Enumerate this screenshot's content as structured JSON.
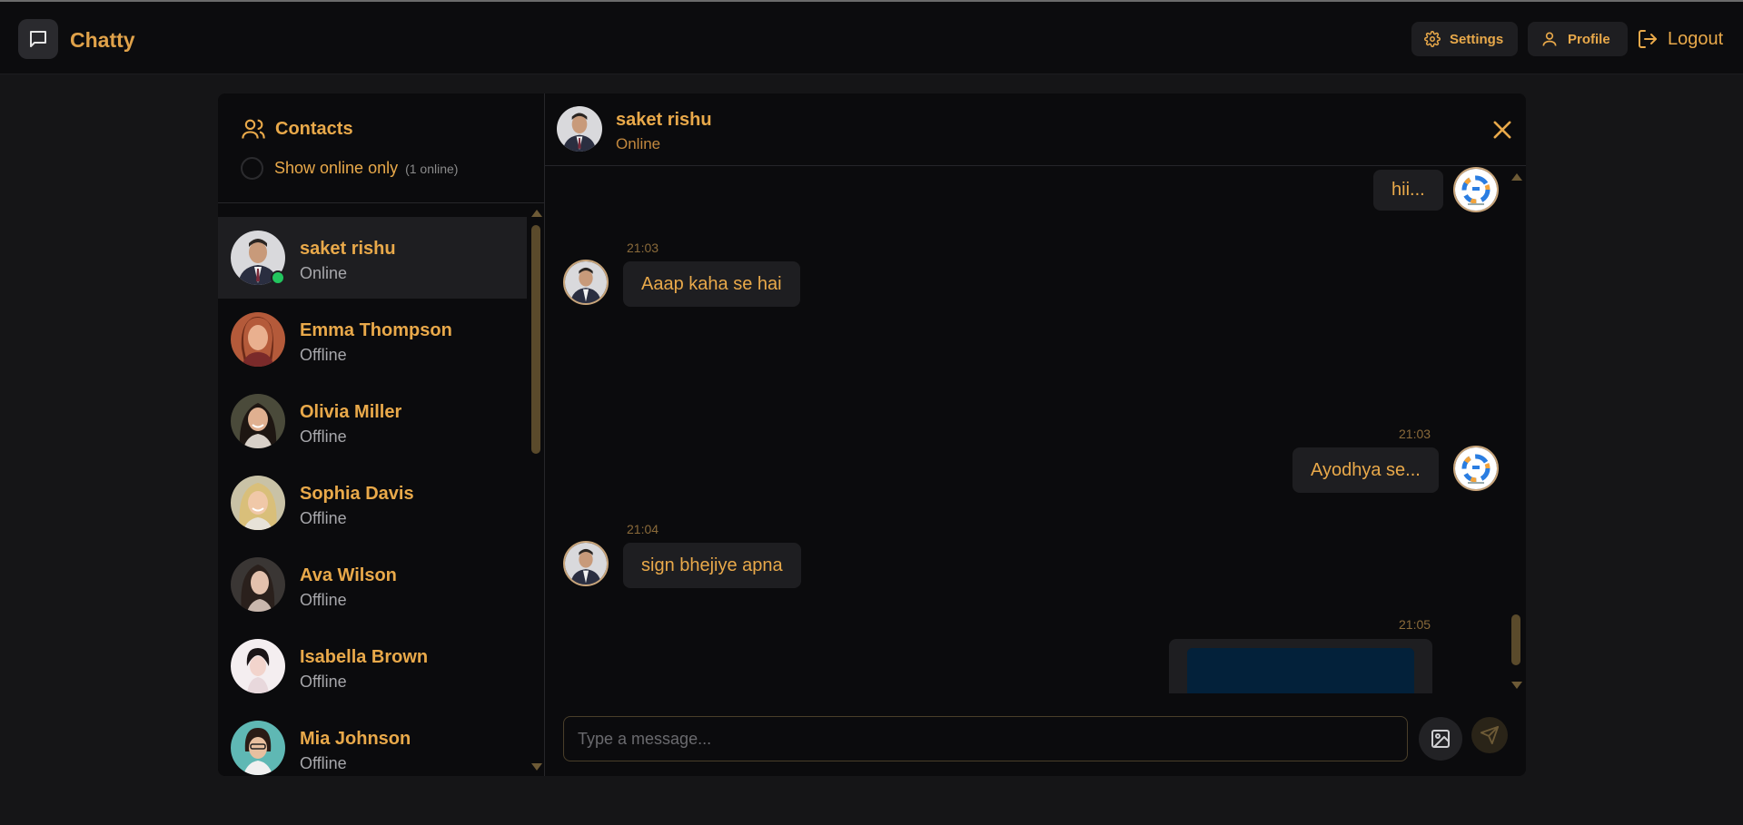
{
  "app": {
    "name": "Chatty",
    "accent_color": "#e9a94a",
    "online_color": "#22c55e"
  },
  "header": {
    "settings_label": "Settings",
    "profile_label": "Profile",
    "logout_label": "Logout"
  },
  "sidebar": {
    "title": "Contacts",
    "filter_label": "Show online only",
    "online_count": "(1 online)",
    "contacts": [
      {
        "name": "saket rishu",
        "status": "Online",
        "active": true
      },
      {
        "name": "Emma Thompson",
        "status": "Offline"
      },
      {
        "name": "Olivia Miller",
        "status": "Offline"
      },
      {
        "name": "Sophia Davis",
        "status": "Offline"
      },
      {
        "name": "Ava Wilson",
        "status": "Offline"
      },
      {
        "name": "Isabella Brown",
        "status": "Offline"
      },
      {
        "name": "Mia Johnson",
        "status": "Offline"
      }
    ]
  },
  "chat": {
    "contact_name": "saket rishu",
    "contact_status": "Online",
    "messages": [
      {
        "side": "sent",
        "text": "hii..."
      },
      {
        "side": "received",
        "time": "21:03",
        "text": "Aaap kaha se hai"
      },
      {
        "side": "sent",
        "time": "21:03",
        "text": "Ayodhya se..."
      },
      {
        "side": "received",
        "time": "21:04",
        "text": "sign bhejiye apna"
      },
      {
        "side": "sent",
        "time": "21:05",
        "type": "image"
      }
    ],
    "input_placeholder": "Type a message..."
  }
}
